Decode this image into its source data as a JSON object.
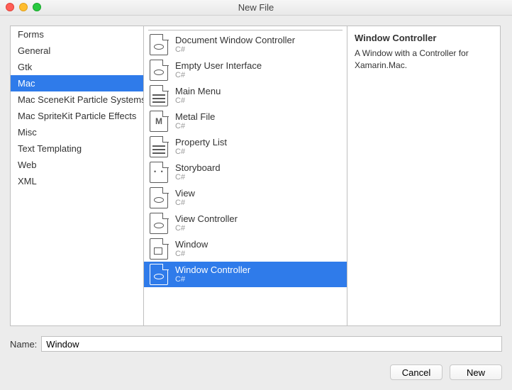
{
  "window": {
    "title": "New File"
  },
  "categories": [
    {
      "label": "Forms",
      "selected": false
    },
    {
      "label": "General",
      "selected": false
    },
    {
      "label": "Gtk",
      "selected": false
    },
    {
      "label": "Mac",
      "selected": true
    },
    {
      "label": "Mac SceneKit Particle Systems",
      "selected": false
    },
    {
      "label": "Mac SpriteKit Particle Effects",
      "selected": false
    },
    {
      "label": "Misc",
      "selected": false
    },
    {
      "label": "Text Templating",
      "selected": false
    },
    {
      "label": "Web",
      "selected": false
    },
    {
      "label": "XML",
      "selected": false
    }
  ],
  "templates": [
    {
      "label": "Document Window Controller",
      "sub": "C#",
      "icon": "gear",
      "selected": false
    },
    {
      "label": "Empty User Interface",
      "sub": "C#",
      "icon": "eye",
      "selected": false
    },
    {
      "label": "Main Menu",
      "sub": "C#",
      "icon": "lines",
      "selected": false
    },
    {
      "label": "Metal File",
      "sub": "C#",
      "icon": "m",
      "selected": false
    },
    {
      "label": "Property List",
      "sub": "C#",
      "icon": "lines",
      "selected": false
    },
    {
      "label": "Storyboard",
      "sub": "C#",
      "icon": "dots",
      "selected": false
    },
    {
      "label": "View",
      "sub": "C#",
      "icon": "eye",
      "selected": false
    },
    {
      "label": "View Controller",
      "sub": "C#",
      "icon": "gear",
      "selected": false
    },
    {
      "label": "Window",
      "sub": "C#",
      "icon": "box",
      "selected": false
    },
    {
      "label": "Window Controller",
      "sub": "C#",
      "icon": "eye",
      "selected": true
    }
  ],
  "description": {
    "title": "Window Controller",
    "body": "A Window with a Controller for Xamarin.Mac."
  },
  "name_field": {
    "label": "Name:",
    "value": "Window"
  },
  "buttons": {
    "cancel": "Cancel",
    "new": "New"
  }
}
